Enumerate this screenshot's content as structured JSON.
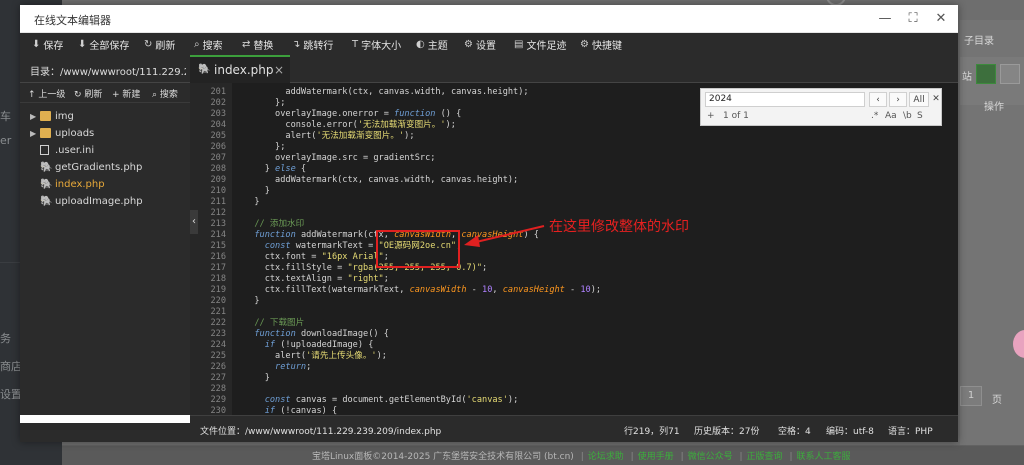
{
  "window": {
    "title": "在线文本编辑器",
    "minimize": "—",
    "maximize": "⛶",
    "close": "✕"
  },
  "toolbar": [
    {
      "icon": "save-icon",
      "label": "保存"
    },
    {
      "icon": "save-all-icon",
      "label": "全部保存"
    },
    {
      "icon": "refresh-icon",
      "label": "刷新"
    },
    {
      "icon": "search-icon",
      "label": "搜索"
    },
    {
      "icon": "replace-icon",
      "label": "替换"
    },
    {
      "icon": "goto-line-icon",
      "label": "跳转行"
    },
    {
      "icon": "font-size-icon",
      "label": "字体大小"
    },
    {
      "icon": "theme-icon",
      "label": "主题"
    },
    {
      "icon": "settings-icon",
      "label": "设置"
    },
    {
      "icon": "file-footprint-icon",
      "label": "文件足迹"
    },
    {
      "icon": "shortcut-icon",
      "label": "快捷键"
    }
  ],
  "path": {
    "label": "目录：/www/wwwroot/111.229.239..."
  },
  "sidebar": {
    "tools": [
      {
        "icon": "up-level-icon",
        "label": "上一级"
      },
      {
        "icon": "refresh-icon",
        "label": "刷新"
      },
      {
        "icon": "new-icon",
        "label": "新建"
      },
      {
        "icon": "search-icon",
        "label": "搜索"
      }
    ],
    "items": [
      {
        "type": "folder",
        "name": "img"
      },
      {
        "type": "folder",
        "name": "uploads"
      },
      {
        "type": "file",
        "name": ".user.ini"
      },
      {
        "type": "php",
        "name": "getGradients.php"
      },
      {
        "type": "php",
        "name": "index.php",
        "active": true
      },
      {
        "type": "php",
        "name": "uploadImage.php"
      }
    ]
  },
  "tab": {
    "name": "index.php",
    "close": "×"
  },
  "find": {
    "query": "2024",
    "prev": "‹",
    "next": "›",
    "all": "All",
    "close": "✕",
    "plus": "+",
    "result": "1 of 1",
    "opt_regex": ".*",
    "opt_case": "Aa",
    "opt_word": "\\b",
    "opt_sel": "S"
  },
  "code": {
    "lines": [
      {
        "n": "201",
        "text": "        addWatermark(ctx, canvas.width, canvas.height);"
      },
      {
        "n": "202",
        "text": "      };"
      },
      {
        "n": "203",
        "text": "      overlayImage.onerror = function () {"
      },
      {
        "n": "204",
        "text": "        console.error('无法加载渐变图片。');"
      },
      {
        "n": "205",
        "text": "        alert('无法加载渐变图片。');"
      },
      {
        "n": "206",
        "text": "      };"
      },
      {
        "n": "207",
        "text": "      overlayImage.src = gradientSrc;"
      },
      {
        "n": "208",
        "text": "    } else {"
      },
      {
        "n": "209",
        "text": "      addWatermark(ctx, canvas.width, canvas.height);"
      },
      {
        "n": "210",
        "text": "    }"
      },
      {
        "n": "211",
        "text": "  }"
      },
      {
        "n": "212",
        "text": ""
      },
      {
        "n": "213",
        "text": "  // 添加水印"
      },
      {
        "n": "214",
        "text": "  function addWatermark(ctx, canvasWidth, canvasHeight) {"
      },
      {
        "n": "215",
        "text": "    const watermarkText = \"OE源码网2oe.cn\";"
      },
      {
        "n": "216",
        "text": "    ctx.font = \"16px Arial\";"
      },
      {
        "n": "217",
        "text": "    ctx.fillStyle = \"rgba(255, 255, 255, 0.7)\";"
      },
      {
        "n": "218",
        "text": "    ctx.textAlign = \"right\";"
      },
      {
        "n": "219",
        "text": "    ctx.fillText(watermarkText, canvasWidth - 10, canvasHeight - 10);"
      },
      {
        "n": "220",
        "text": "  }"
      },
      {
        "n": "221",
        "text": ""
      },
      {
        "n": "222",
        "text": "  // 下载图片"
      },
      {
        "n": "223",
        "text": "  function downloadImage() {"
      },
      {
        "n": "224",
        "text": "    if (!uploadedImage) {"
      },
      {
        "n": "225",
        "text": "      alert('请先上传头像。');"
      },
      {
        "n": "226",
        "text": "      return;"
      },
      {
        "n": "227",
        "text": "    }"
      },
      {
        "n": "228",
        "text": ""
      },
      {
        "n": "229",
        "text": "    const canvas = document.getElementById('canvas');"
      },
      {
        "n": "230",
        "text": "    if (!canvas) {"
      }
    ]
  },
  "annotation": {
    "text": "在这里修改整体的水印"
  },
  "status": {
    "file_path": "文件位置：/www/wwwroot/111.229.239.209/index.php",
    "position": "行219，列71",
    "history": "历史版本：27份",
    "indent": "空格：4",
    "encoding": "编码：utf-8",
    "language": "语言：PHP"
  },
  "background": {
    "left_items": [
      "车",
      "er",
      "务",
      "商店",
      "设置"
    ],
    "top_right": "子目录",
    "panel_label": "站",
    "col_header": "操作",
    "page_num": "1",
    "page_unit": "页",
    "footer": "宝塔Linux面板©2014-2025 广东堡塔安全技术有限公司 (bt.cn)",
    "footer_links": [
      "论坛求助",
      "使用手册",
      "微信公众号",
      "正版查询",
      "联系人工客服"
    ]
  },
  "colors": {
    "accent": "#3c9f3c",
    "annotation": "#e02020"
  }
}
